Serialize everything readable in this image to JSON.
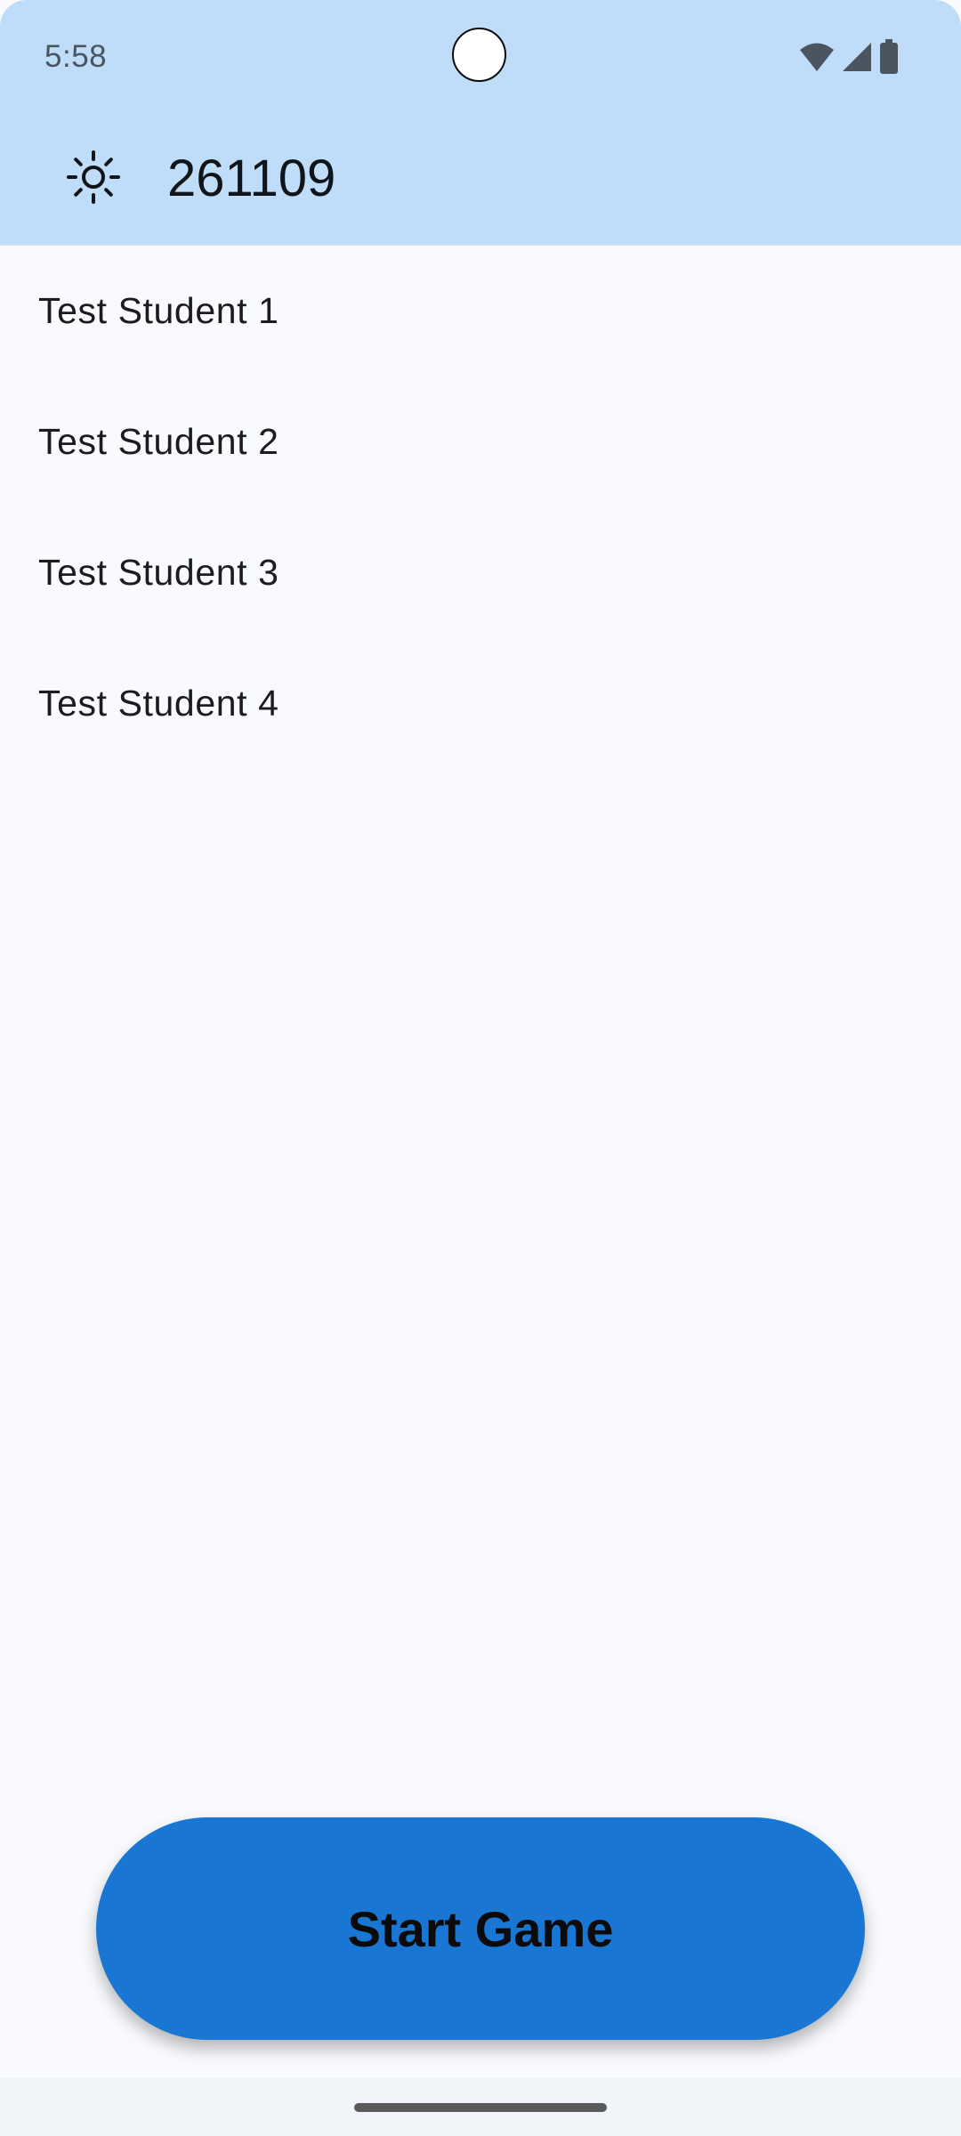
{
  "status_bar": {
    "time": "5:58",
    "icons": [
      "wifi-icon",
      "cell-signal-icon",
      "battery-icon"
    ]
  },
  "app_bar": {
    "theme_icon": "sun-icon",
    "game_code": "261109"
  },
  "students": [
    {
      "name": "Test Student 1"
    },
    {
      "name": "Test Student 2"
    },
    {
      "name": "Test Student 3"
    },
    {
      "name": "Test Student 4"
    }
  ],
  "actions": {
    "start_label": "Start Game"
  },
  "colors": {
    "app_bar_bg": "#bfdcf8",
    "background": "#f8fafd",
    "primary_button": "#1976d2",
    "text": "#1a1c1f"
  }
}
